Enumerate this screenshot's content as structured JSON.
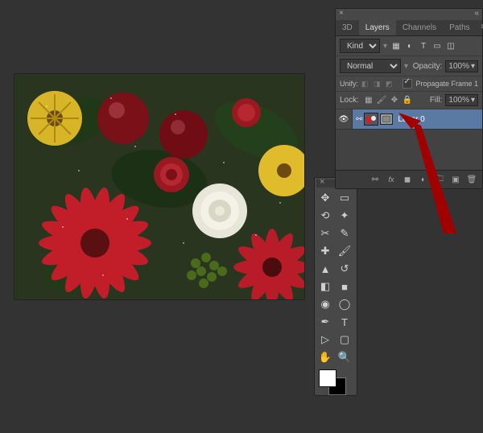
{
  "panel": {
    "tabs": [
      "3D",
      "Layers",
      "Channels",
      "Paths"
    ],
    "active_tab": "Layers",
    "kind_label": "Kind",
    "blend_mode": "Normal",
    "opacity_label": "Opacity:",
    "opacity_value": "100%",
    "unify_label": "Unify:",
    "propagate_label": "Propagate Frame 1",
    "lock_label": "Lock:",
    "fill_label": "Fill:",
    "fill_value": "100%",
    "layers": [
      {
        "name": "Layer 0",
        "visible": true,
        "selected": true
      }
    ],
    "footer_icons": [
      "link-icon",
      "fx-icon",
      "mask-icon",
      "adjust-icon",
      "group-icon",
      "new-icon",
      "trash-icon"
    ]
  },
  "tools": {
    "items": [
      "move-tool",
      "marquee-tool",
      "lasso-tool",
      "quick-select-tool",
      "crop-tool",
      "eyedropper-tool",
      "heal-tool",
      "brush-tool",
      "stamp-tool",
      "history-brush-tool",
      "eraser-tool",
      "gradient-tool",
      "blur-tool",
      "dodge-tool",
      "pen-tool",
      "type-tool",
      "path-select-tool",
      "rectangle-tool",
      "hand-tool",
      "zoom-tool"
    ],
    "fg_color": "#ffffff",
    "bg_color": "#000000"
  }
}
